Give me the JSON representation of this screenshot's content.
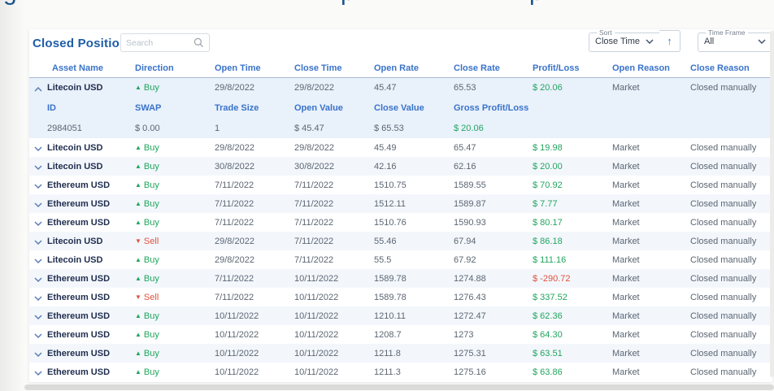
{
  "clipped_heading_fragments": [
    "g",
    "p",
    "p"
  ],
  "header": {
    "title": "Closed Positions",
    "search": {
      "placeholder": "Search"
    },
    "sort": {
      "label": "Sort",
      "value": "Close Time"
    },
    "time_frame": {
      "label": "Time Frame",
      "value": "All"
    }
  },
  "icons": {
    "buy_arrow": "▲",
    "sell_arrow": "▼",
    "sort_direction_arrow": "↑"
  },
  "colors": {
    "accent_blue": "#3973c9",
    "title_blue": "#1d5da8",
    "positive_green": "#21a55e",
    "negative_red": "#e2503c",
    "asset_navy": "#1f2d4e",
    "muted_text": "#5c6673"
  },
  "table": {
    "columns": [
      "Asset Name",
      "Direction",
      "Open Time",
      "Close Time",
      "Open Rate",
      "Close Rate",
      "Profit/Loss",
      "Open Reason",
      "Close Reason"
    ],
    "expanded_columns": [
      "ID",
      "SWAP",
      "Trade Size",
      "Open Value",
      "Close Value",
      "Gross Profit/Loss"
    ],
    "rows": [
      {
        "asset": "Litecoin USD",
        "direction": "Buy",
        "open_time": "29/8/2022",
        "close_time": "29/8/2022",
        "open_rate": "45.47",
        "close_rate": "65.53",
        "profit_loss": "$ 20.06",
        "open_reason": "Market",
        "close_reason": "Closed manually",
        "expanded": true,
        "details": {
          "id": "2984051",
          "swap": "$ 0.00",
          "trade_size": "1",
          "open_value": "$ 45.47",
          "close_value": "$ 65.53",
          "gross_profit_loss": "$ 20.06"
        }
      },
      {
        "asset": "Litecoin USD",
        "direction": "Buy",
        "open_time": "29/8/2022",
        "close_time": "29/8/2022",
        "open_rate": "45.49",
        "close_rate": "65.47",
        "profit_loss": "$ 19.98",
        "open_reason": "Market",
        "close_reason": "Closed manually",
        "expanded": false
      },
      {
        "asset": "Litecoin USD",
        "direction": "Buy",
        "open_time": "30/8/2022",
        "close_time": "30/8/2022",
        "open_rate": "42.16",
        "close_rate": "62.16",
        "profit_loss": "$ 20.00",
        "open_reason": "Market",
        "close_reason": "Closed manually",
        "expanded": false
      },
      {
        "asset": "Ethereum USD",
        "direction": "Buy",
        "open_time": "7/11/2022",
        "close_time": "7/11/2022",
        "open_rate": "1510.75",
        "close_rate": "1589.55",
        "profit_loss": "$ 70.92",
        "open_reason": "Market",
        "close_reason": "Closed manually",
        "expanded": false
      },
      {
        "asset": "Ethereum USD",
        "direction": "Buy",
        "open_time": "7/11/2022",
        "close_time": "7/11/2022",
        "open_rate": "1512.11",
        "close_rate": "1589.87",
        "profit_loss": "$ 7.77",
        "open_reason": "Market",
        "close_reason": "Closed manually",
        "expanded": false
      },
      {
        "asset": "Ethereum USD",
        "direction": "Buy",
        "open_time": "7/11/2022",
        "close_time": "7/11/2022",
        "open_rate": "1510.76",
        "close_rate": "1590.93",
        "profit_loss": "$ 80.17",
        "open_reason": "Market",
        "close_reason": "Closed manually",
        "expanded": false
      },
      {
        "asset": "Litecoin USD",
        "direction": "Sell",
        "open_time": "29/8/2022",
        "close_time": "7/11/2022",
        "open_rate": "55.46",
        "close_rate": "67.94",
        "profit_loss": "$ 86.18",
        "open_reason": "Market",
        "close_reason": "Closed manually",
        "expanded": false
      },
      {
        "asset": "Litecoin USD",
        "direction": "Buy",
        "open_time": "29/8/2022",
        "close_time": "7/11/2022",
        "open_rate": "55.5",
        "close_rate": "67.92",
        "profit_loss": "$ 111.16",
        "open_reason": "Market",
        "close_reason": "Closed manually",
        "expanded": false
      },
      {
        "asset": "Ethereum USD",
        "direction": "Buy",
        "open_time": "7/11/2022",
        "close_time": "10/11/2022",
        "open_rate": "1589.78",
        "close_rate": "1274.88",
        "profit_loss": "$ -290.72",
        "open_reason": "Market",
        "close_reason": "Closed manually",
        "expanded": false
      },
      {
        "asset": "Ethereum USD",
        "direction": "Sell",
        "open_time": "7/11/2022",
        "close_time": "10/11/2022",
        "open_rate": "1589.78",
        "close_rate": "1276.43",
        "profit_loss": "$ 337.52",
        "open_reason": "Market",
        "close_reason": "Closed manually",
        "expanded": false
      },
      {
        "asset": "Ethereum USD",
        "direction": "Buy",
        "open_time": "10/11/2022",
        "close_time": "10/11/2022",
        "open_rate": "1210.11",
        "close_rate": "1272.47",
        "profit_loss": "$ 62.36",
        "open_reason": "Market",
        "close_reason": "Closed manually",
        "expanded": false
      },
      {
        "asset": "Ethereum USD",
        "direction": "Buy",
        "open_time": "10/11/2022",
        "close_time": "10/11/2022",
        "open_rate": "1208.7",
        "close_rate": "1273",
        "profit_loss": "$ 64.30",
        "open_reason": "Market",
        "close_reason": "Closed manually",
        "expanded": false
      },
      {
        "asset": "Ethereum USD",
        "direction": "Buy",
        "open_time": "10/11/2022",
        "close_time": "10/11/2022",
        "open_rate": "1211.8",
        "close_rate": "1275.31",
        "profit_loss": "$ 63.51",
        "open_reason": "Market",
        "close_reason": "Closed manually",
        "expanded": false
      },
      {
        "asset": "Ethereum USD",
        "direction": "Buy",
        "open_time": "10/11/2022",
        "close_time": "10/11/2022",
        "open_rate": "1211.3",
        "close_rate": "1275.16",
        "profit_loss": "$ 63.86",
        "open_reason": "Market",
        "close_reason": "Closed manually",
        "expanded": false
      }
    ]
  }
}
